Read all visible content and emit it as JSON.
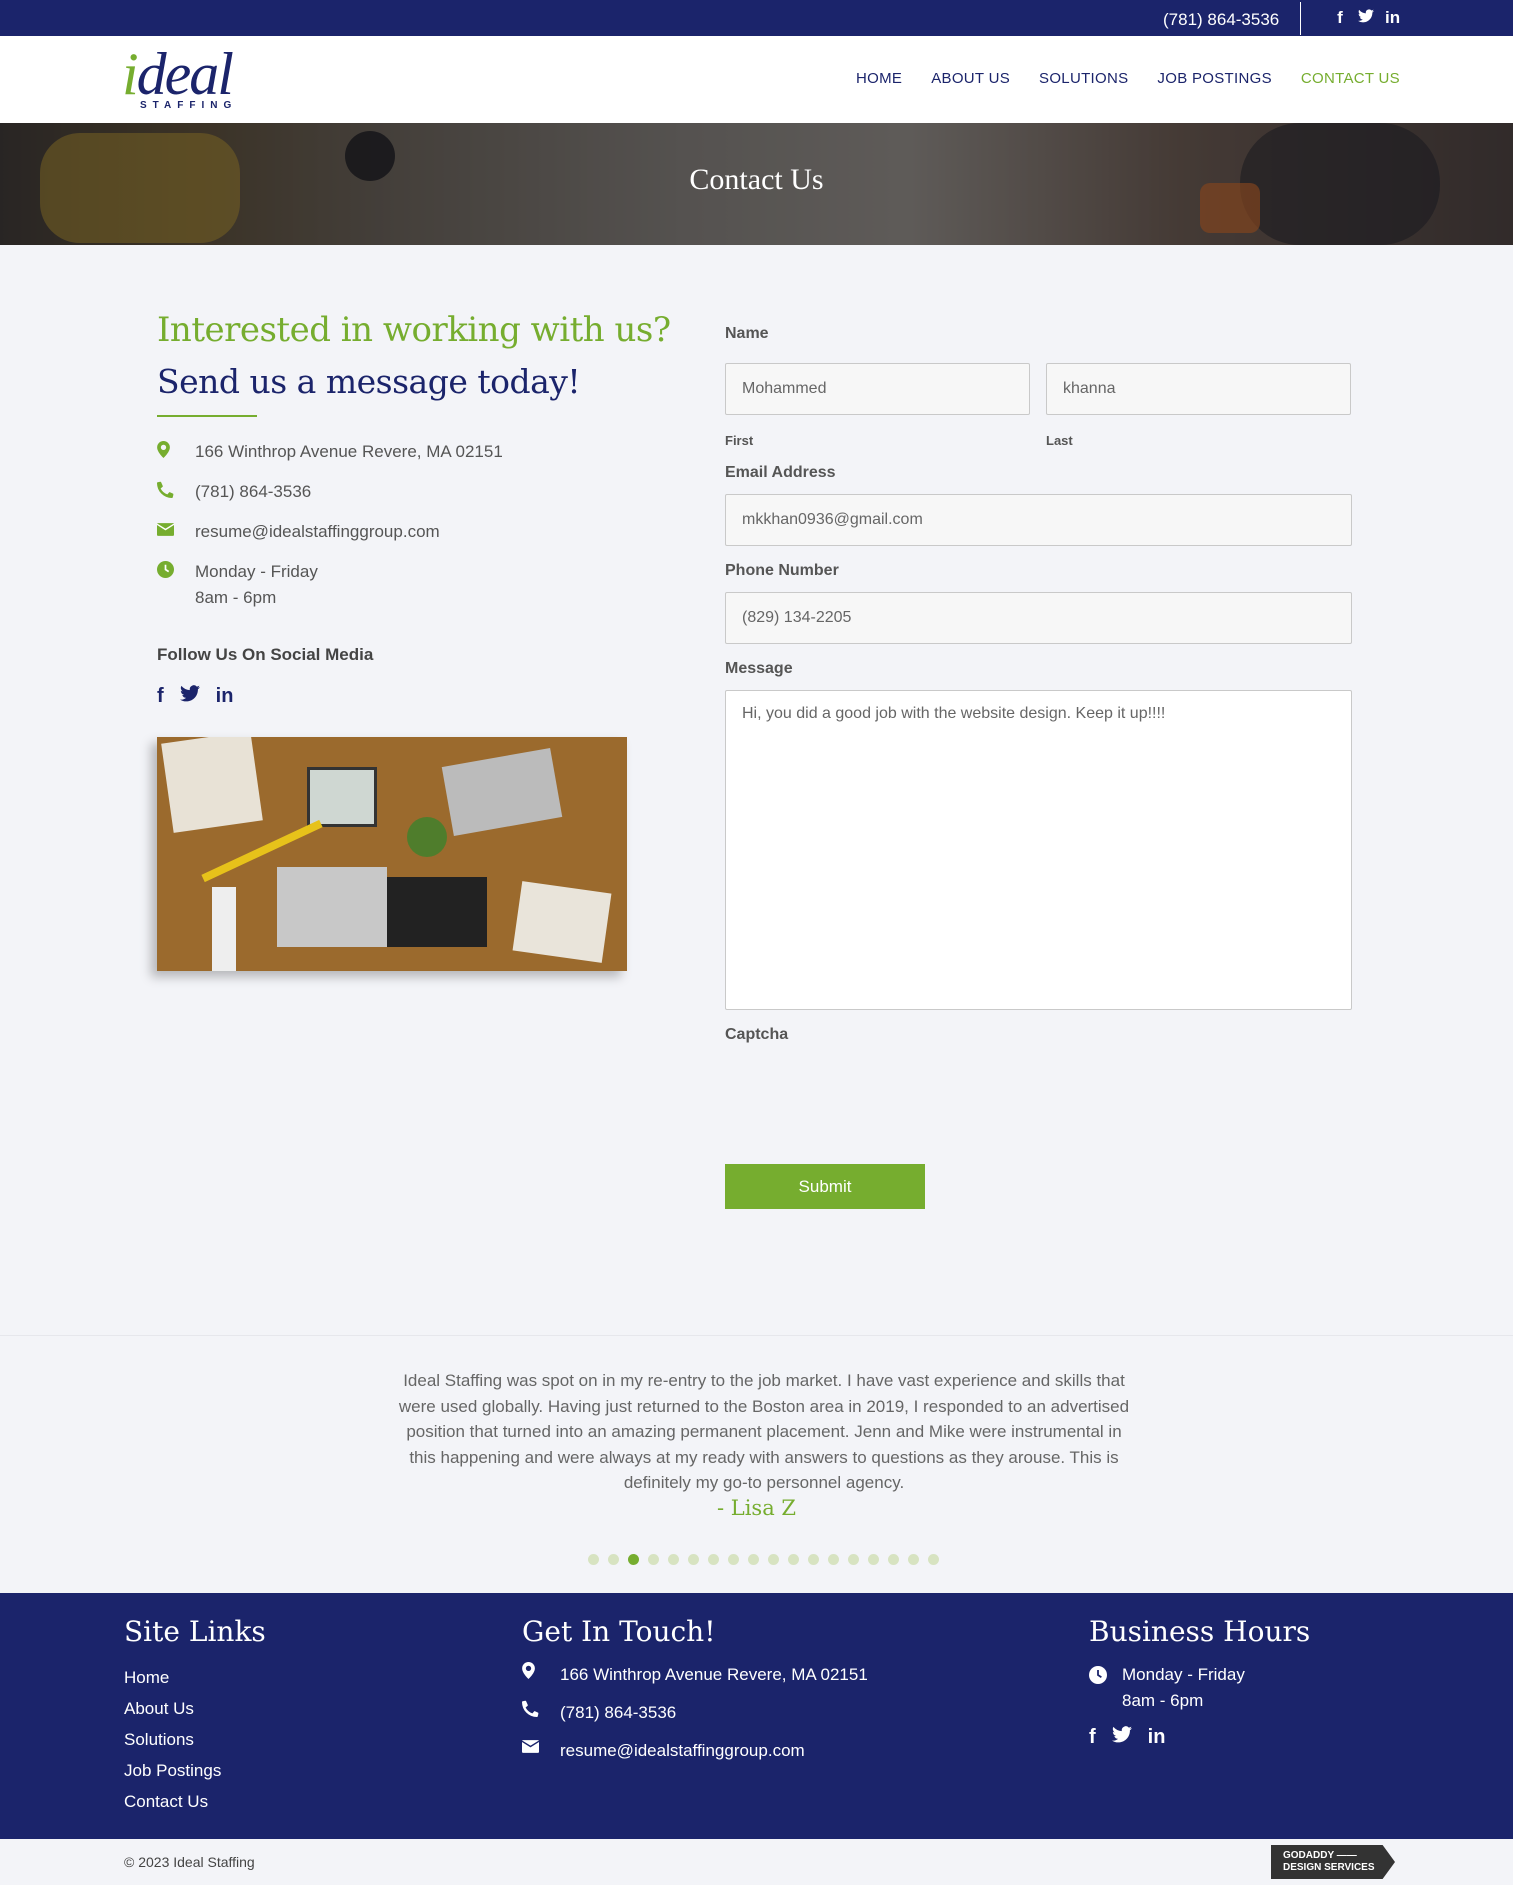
{
  "topbar": {
    "phone": "(781) 864-3536",
    "social_icons": [
      "f",
      "𝕥",
      "in"
    ]
  },
  "header": {
    "logo": {
      "word_i": "i",
      "word_rest": "deal",
      "sub": "STAFFING"
    },
    "nav": [
      {
        "label": "HOME",
        "active": false
      },
      {
        "label": "ABOUT US",
        "active": false
      },
      {
        "label": "SOLUTIONS",
        "active": false
      },
      {
        "label": "JOB POSTINGS",
        "active": false
      },
      {
        "label": "CONTACT US",
        "active": true
      }
    ]
  },
  "hero": {
    "title": "Contact Us"
  },
  "intro": {
    "heading_green": "Interested in working with us?",
    "heading_navy": "Send us a message today!",
    "address": "166 Winthrop Avenue Revere, MA 02151",
    "phone": "(781) 864-3536",
    "email": "resume@idealstaffinggroup.com",
    "hours_days": "Monday - Friday",
    "hours_time": "8am - 6pm",
    "follow_label": "Follow Us On Social Media"
  },
  "form": {
    "name_label": "Name",
    "first_value": "Mohammed",
    "last_value": "khanna",
    "first_sublabel": "First",
    "last_sublabel": "Last",
    "email_label": "Email Address",
    "email_value": "mkkhan0936@gmail.com",
    "phone_label": "Phone Number",
    "phone_value": "(829) 134-2205",
    "message_label": "Message",
    "message_value": "Hi, you did a good job with the website design. Keep it up!!!!",
    "captcha_label": "Captcha",
    "submit_label": "Submit"
  },
  "testimonial": {
    "quote": "Ideal Staffing was spot on in my re-entry to the job market. I have vast experience and skills that were used globally. Having just returned to the Boston area in 2019, I responded to an advertised position that turned into an amazing permanent placement. Jenn and Mike were instrumental in this happening and were always at my ready with answers to questions as they arouse. This is definitely my go-to personnel agency.",
    "author": "- Lisa Z",
    "dot_count": 18,
    "active_dot": 3
  },
  "footer": {
    "site_links_title": "Site Links",
    "site_links": [
      "Home",
      "About Us",
      "Solutions",
      "Job Postings",
      "Contact Us"
    ],
    "touch_title": "Get In Touch!",
    "address": "166 Winthrop Avenue Revere, MA 02151",
    "phone": "(781) 864-3536",
    "email": "resume@idealstaffinggroup.com",
    "hours_title": "Business Hours",
    "hours_days": "Monday - Friday",
    "hours_time": "8am - 6pm"
  },
  "bottom": {
    "copyright": "© 2023 Ideal Staffing",
    "badge_line1": "GODADDY ——",
    "badge_line2": "DESIGN SERVICES"
  },
  "colors": {
    "navy": "#1b246b",
    "green": "#76ad2f"
  }
}
